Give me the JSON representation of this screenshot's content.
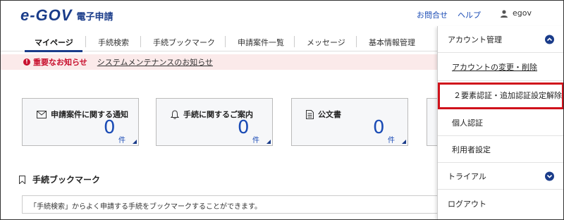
{
  "header": {
    "logo_mark": "e-GOV",
    "logo_text": "電子申請",
    "contact": "お問合せ",
    "help": "ヘルプ",
    "user": "egov"
  },
  "nav": {
    "items": [
      "マイページ",
      "手続検索",
      "手続ブックマーク",
      "申請案件一覧",
      "メッセージ",
      "基本情報管理"
    ]
  },
  "notice": {
    "label": "重要なお知らせ",
    "link": "システムメンテナンスのお知らせ"
  },
  "cards": [
    {
      "title": "申請案件に関する通知",
      "count": "0",
      "unit": "件",
      "icon": "envelope-icon"
    },
    {
      "title": "手続に関するご案内",
      "count": "0",
      "unit": "件",
      "icon": "bell-icon"
    },
    {
      "title": "公文書",
      "count": "0",
      "unit": "件",
      "icon": "document-icon"
    }
  ],
  "bookmark": {
    "title": "手続ブックマーク",
    "description": "「手続検索」からよく申請する手続をブックマークすることができます。"
  },
  "dropdown": {
    "account_header": "アカウント管理",
    "account_change": "アカウントの変更・削除",
    "two_factor": "２要素認証・追加認証設定解除",
    "personal_auth": "個人認証",
    "user_settings": "利用者設定",
    "trial": "トライアル",
    "logout": "ログアウト"
  },
  "colors": {
    "brand": "#1a3c8a",
    "link": "#1a4bb5",
    "alert": "#c8102e",
    "highlight": "#d0121b"
  }
}
